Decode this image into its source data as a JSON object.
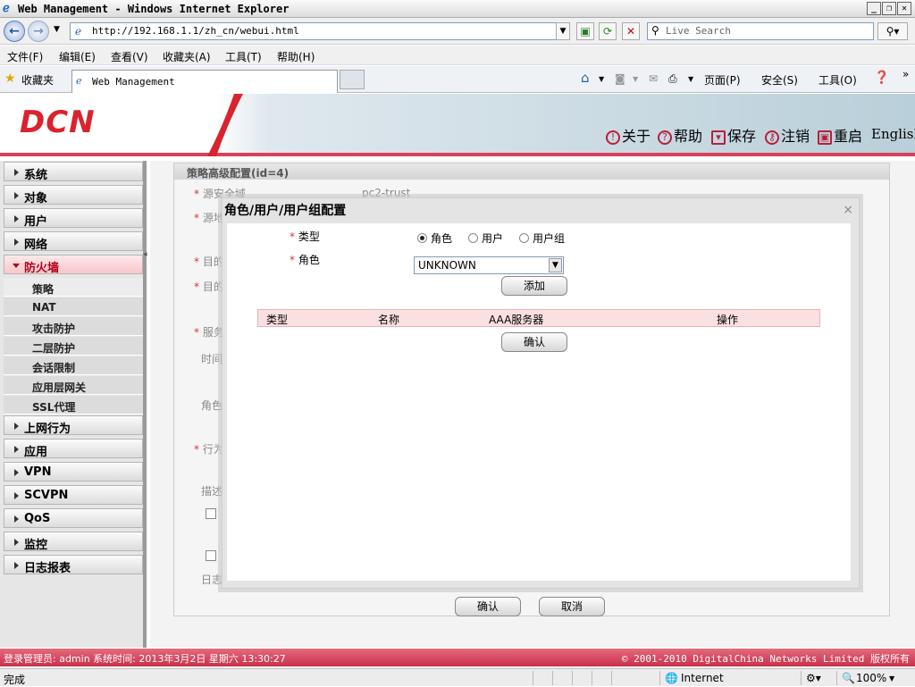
{
  "browser": {
    "window_title": "Web Management - Windows Internet Explorer",
    "url": "http://192.168.1.1/zh_cn/webui.html",
    "search_placeholder": "Live Search",
    "menu": [
      "文件(F)",
      "编辑(E)",
      "查看(V)",
      "收藏夹(A)",
      "工具(T)",
      "帮助(H)"
    ],
    "favorites_label": "收藏夹",
    "tab_title": "Web Management",
    "cmd_page": "页面(P)",
    "cmd_safety": "安全(S)",
    "cmd_tools": "工具(O)",
    "status_left": "完成",
    "status_zone": "Internet",
    "zoom": "100%"
  },
  "app": {
    "logo": "DCN",
    "top_links": {
      "about": "关于",
      "help": "帮助",
      "save": "保存",
      "logout": "注销",
      "restart": "重启",
      "english": "English"
    }
  },
  "sidebar": {
    "items": [
      "系统",
      "对象",
      "用户",
      "网络",
      "防火墙"
    ],
    "sub_items": [
      "策略",
      "NAT",
      "攻击防护",
      "二层防护",
      "会话限制",
      "应用层网关",
      "SSL代理"
    ],
    "items_after": [
      "上网行为",
      "应用",
      "VPN",
      "SCVPN",
      "QoS",
      "监控",
      "日志报表"
    ]
  },
  "panel": {
    "title": "策略高级配置(id=4)",
    "src_zone_label": "源安全域",
    "src_zone_value": "pc2-trust",
    "partial_labels": [
      "源地",
      "目的",
      "目的",
      "服务",
      "时间",
      "角色",
      "行为",
      "描述",
      "日志"
    ],
    "confirm": "确认",
    "cancel": "取消"
  },
  "dialog": {
    "title": "角色/用户/用户组配置",
    "close": "×",
    "type_label": "类型",
    "type_options": [
      "角色",
      "用户",
      "用户组"
    ],
    "role_label": "角色",
    "role_value": "UNKNOWN",
    "add_button": "添加",
    "table_headers": [
      "类型",
      "名称",
      "AAA服务器",
      "操作"
    ],
    "confirm_button": "确认"
  },
  "footer": {
    "left": "登录管理员: admin 系统时间: 2013年3月2日 星期六 13:30:27",
    "right": "© 2001-2010 DigitalChina Networks Limited 版权所有"
  }
}
